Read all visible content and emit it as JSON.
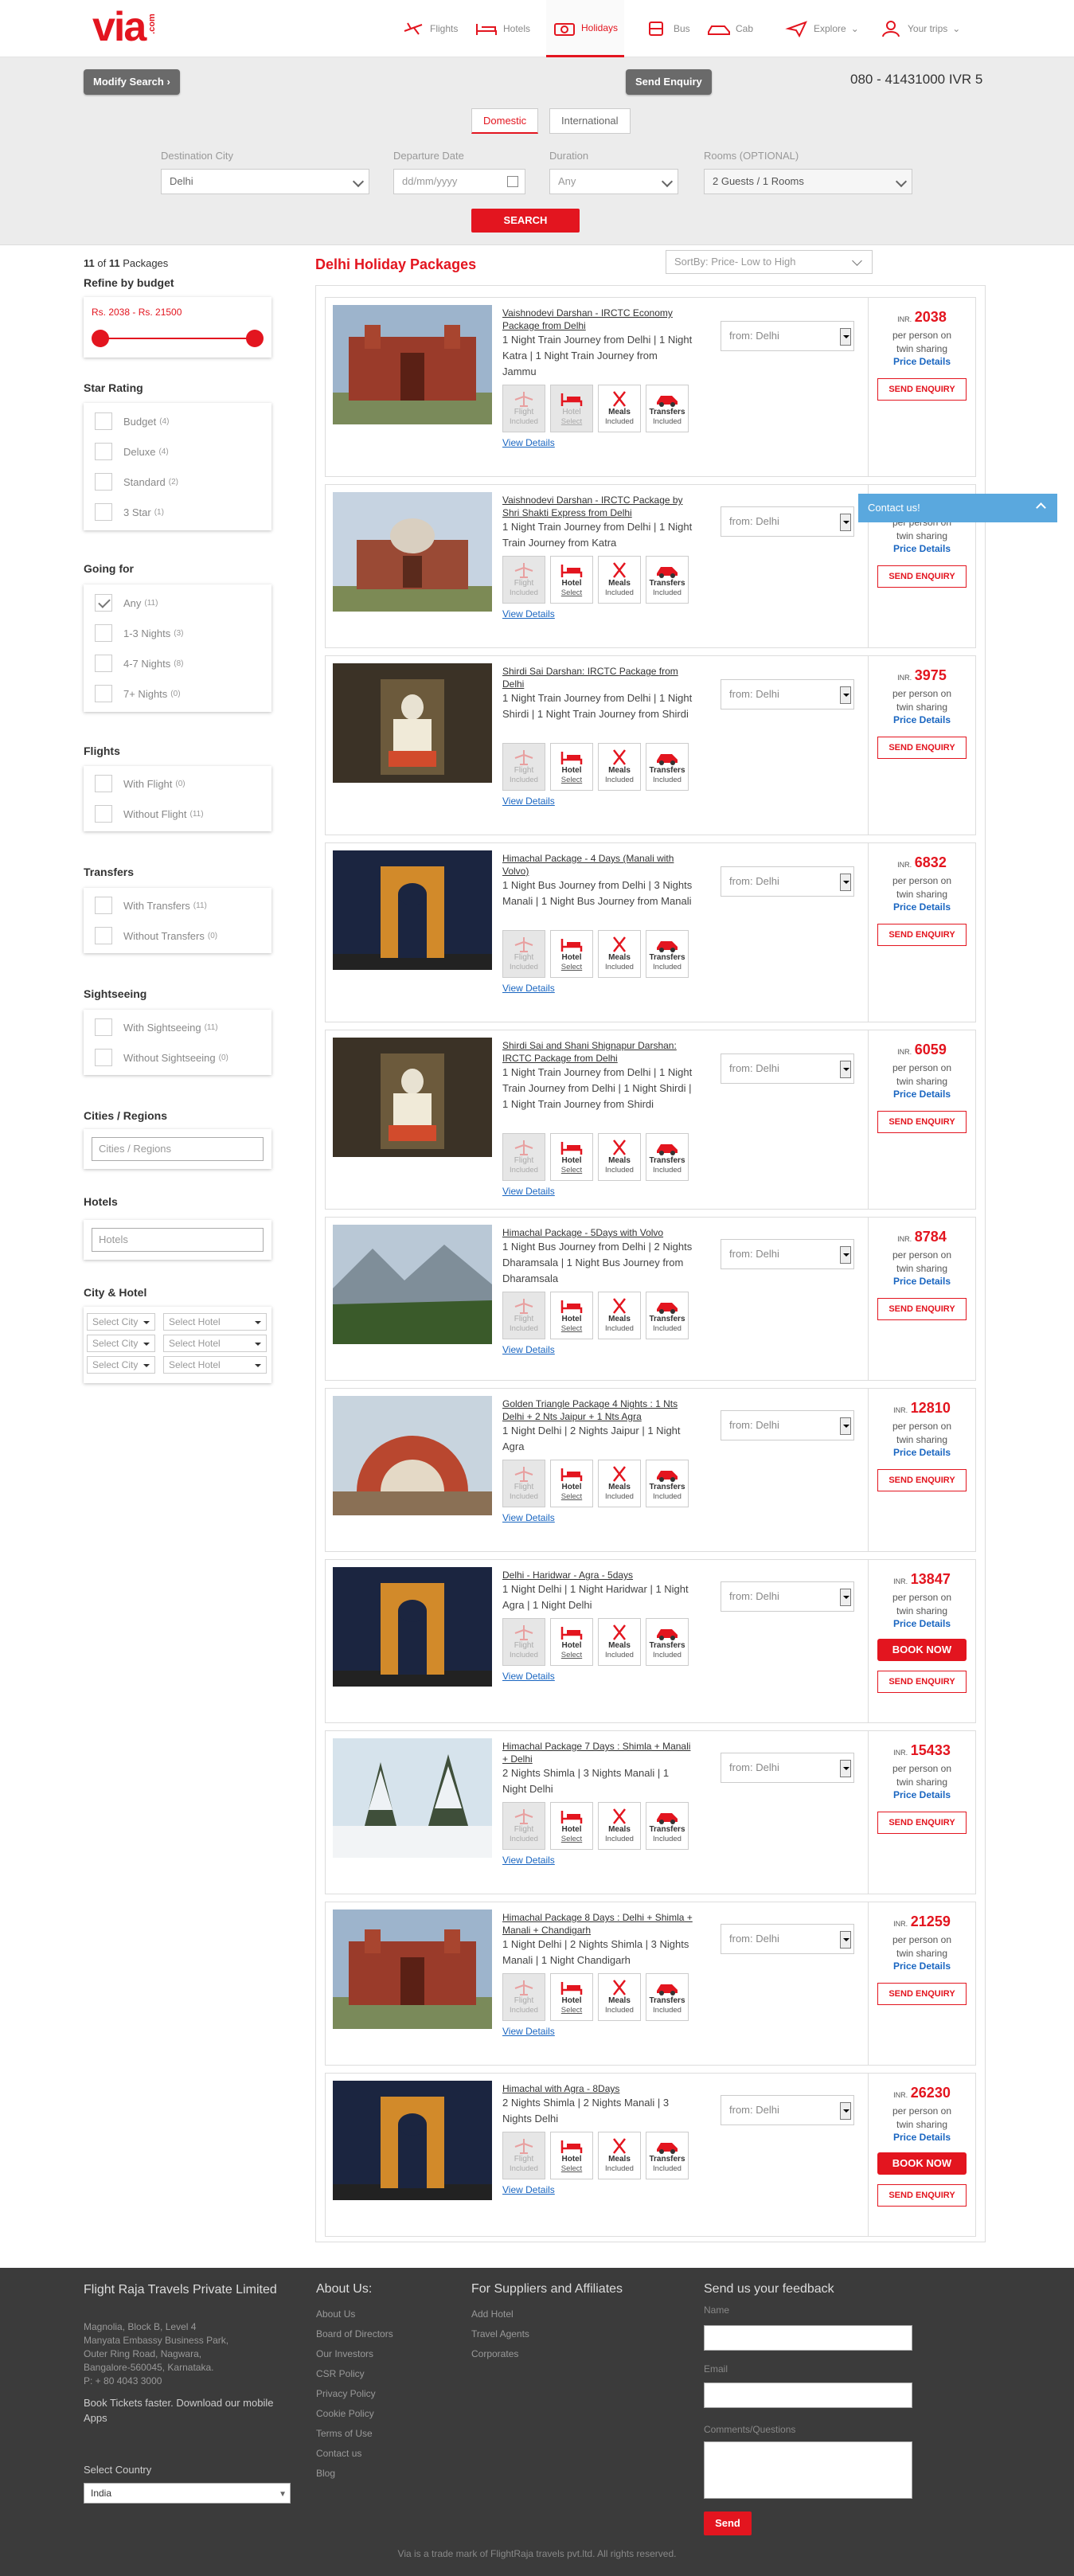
{
  "header": {
    "logo": "via",
    "logo_suffix": ".com",
    "nav": [
      {
        "label": "Flights",
        "icon": "plane-icon"
      },
      {
        "label": "Hotels",
        "icon": "bed-icon"
      },
      {
        "label": "Holidays",
        "icon": "camera-icon",
        "active": true
      },
      {
        "label": "Bus",
        "icon": "bus-icon"
      },
      {
        "label": "Cab",
        "icon": "car-icon"
      },
      {
        "label": "Explore",
        "icon": "paper-plane-icon"
      },
      {
        "label": "Your trips",
        "icon": "user-icon"
      }
    ]
  },
  "search": {
    "modify_label": "Modify Search",
    "send_enquiry_label": "Send Enquiry",
    "phone": "080 - 41431000 IVR 5",
    "tabs": [
      "Domestic",
      "International"
    ],
    "destination_label": "Destination City",
    "destination_value": "Delhi",
    "departure_label": "Departure Date",
    "departure_placeholder": "dd/mm/yyyy",
    "duration_label": "Duration",
    "duration_value": "Any",
    "rooms_label": "Rooms (OPTIONAL)",
    "rooms_value": "2 Guests / 1 Rooms",
    "search_label": "SEARCH"
  },
  "sidebar": {
    "count_shown": "11",
    "count_of": " of ",
    "count_total": "11",
    "count_suffix": " Packages",
    "budget_title": "Refine by budget",
    "budget_range": "Rs. 2038 - Rs. 21500",
    "budget_min": 2038,
    "budget_max": 21500,
    "star_title": "Star Rating",
    "star": [
      {
        "label": "Budget",
        "count": "(4)"
      },
      {
        "label": "Deluxe",
        "count": "(4)"
      },
      {
        "label": "Standard",
        "count": "(2)"
      },
      {
        "label": "3 Star",
        "count": "(1)"
      }
    ],
    "going_title": "Going for",
    "going": [
      {
        "label": "Any",
        "count": "(11)",
        "checked": true
      },
      {
        "label": "1-3 Nights",
        "count": "(3)"
      },
      {
        "label": "4-7 Nights",
        "count": "(8)"
      },
      {
        "label": "7+ Nights",
        "count": "(0)"
      }
    ],
    "flights_title": "Flights",
    "flights": [
      {
        "label": "With Flight",
        "count": "(0)"
      },
      {
        "label": "Without Flight",
        "count": "(11)"
      }
    ],
    "transfers_title": "Transfers",
    "transfers": [
      {
        "label": "With Transfers",
        "count": "(11)"
      },
      {
        "label": "Without Transfers",
        "count": "(0)"
      }
    ],
    "sightseeing_title": "Sightseeing",
    "sightseeing": [
      {
        "label": "With Sightseeing",
        "count": "(11)"
      },
      {
        "label": "Without Sightseeing",
        "count": "(0)"
      }
    ],
    "cities_title": "Cities / Regions",
    "cities_placeholder": "Cities / Regions",
    "hotels_title": "Hotels",
    "hotels_placeholder": "Hotels",
    "cityhotel_title": "City & Hotel",
    "select_city": "Select City",
    "select_hotel": "Select Hotel"
  },
  "listing": {
    "title": "Delhi Holiday Packages",
    "sort_label": "SortBy: Price- Low to High",
    "contact_label": "Contact us!",
    "view_details": "View Details",
    "from_label": "from: Delhi",
    "inr": "INR.",
    "per_person": "per person on twin sharing",
    "price_details": "Price Details",
    "send_enquiry": "SEND ENQUIRY",
    "book_now": "BOOK NOW",
    "features": {
      "flight": "Flight",
      "flight_sub": "Included",
      "hotel": "Hotel",
      "hotel_sub": "Select",
      "meals": "Meals",
      "meals_sub": "Included",
      "transfers": "Transfers",
      "transfers_sub": "Included"
    },
    "packages": [
      {
        "name": "Vaishnodevi Darshan - IRCTC Economy Package from Delhi",
        "desc": "1 Night Train Journey from  Delhi | 1 Night Katra | 1 Night Train Journey from  Jammu",
        "price": "2038",
        "image": "fort-icon",
        "hotel_dim": true,
        "book": false
      },
      {
        "name": "Vaishnodevi Darshan - IRCTC Package by Shri Shakti Express from Delhi",
        "desc": "1 Night Train Journey from  Delhi | 1 Night Train Journey from  Katra",
        "price": "",
        "image": "tomb-icon",
        "hotel_dim": false,
        "book": false
      },
      {
        "name": "Shirdi Sai Darshan: IRCTC Package from Delhi",
        "desc": "1 Night Train Journey from  Delhi | 1 Night Shirdi | 1 Night Train Journey from  Shirdi",
        "price": "3975",
        "image": "idol-icon",
        "hotel_dim": false,
        "book": false
      },
      {
        "name": "Himachal Package - 4 Days (Manali with Volvo)",
        "desc": "1 Night Bus Journey from  Delhi | 3 Nights Manali | 1 Night Bus Journey from  Manali",
        "price": "6832",
        "image": "gate-icon",
        "hotel_dim": false,
        "book": false
      },
      {
        "name": "Shirdi Sai and Shani Shignapur Darshan: IRCTC Package from Delhi",
        "desc": "1 Night Train Journey from  Delhi | 1 Night Train Journey from  Delhi | 1 Night Shirdi | 1 Night Train Journey from  Shirdi",
        "price": "6059",
        "image": "idol-icon",
        "hotel_dim": false,
        "book": false
      },
      {
        "name": "Himachal Package - 5Days with Volvo",
        "desc": "1 Night Bus Journey from  Delhi | 2 Nights Dharamsala | 1 Night Bus Journey from  Dharamsala",
        "price": "8784",
        "image": "mountain-icon",
        "hotel_dim": false,
        "book": false
      },
      {
        "name": "Golden Triangle Package 4 Nights : 1 Nts Delhi + 2 Nts Jaipur + 1 Nts Agra",
        "desc": "1 Night Delhi | 2 Nights Jaipur | 1 Night Agra",
        "price": "12810",
        "image": "jantar-icon",
        "hotel_dim": false,
        "book": false
      },
      {
        "name": "Delhi - Haridwar - Agra - 5days",
        "desc": "1 Night Delhi | 1 Night Haridwar | 1 Night Agra | 1 Night Delhi",
        "price": "13847",
        "image": "gate-icon",
        "hotel_dim": false,
        "book": true
      },
      {
        "name": "Himachal Package 7 Days : Shimla + Manali + Delhi",
        "desc": "2 Nights Shimla | 3 Nights Manali | 1 Night Delhi",
        "price": "15433",
        "image": "snow-icon",
        "hotel_dim": false,
        "book": false
      },
      {
        "name": "Himachal Package 8 Days : Delhi + Shimla + Manali + Chandigarh",
        "desc": "1 Night Delhi | 2 Nights Shimla | 3 Nights Manali | 1 Night Chandigarh",
        "price": "21259",
        "image": "fort-icon",
        "hotel_dim": false,
        "book": false
      },
      {
        "name": "Himachal with Agra - 8Days",
        "desc": "2 Nights Shimla | 2 Nights Manali | 3 Nights Delhi",
        "price": "26230",
        "image": "gate-icon",
        "hotel_dim": false,
        "book": true
      }
    ]
  },
  "footer": {
    "company": "Flight Raja Travels Private Limited",
    "address": [
      "Magnolia, Block B, Level 4",
      "Manyata Embassy Business Park,",
      "Outer Ring Road, Nagwara,",
      "Bangalore-560045, Karnataka.",
      "P: + 80 4043 3000"
    ],
    "apps_text": "Book Tickets faster. Download our mobile Apps",
    "country_label": "Select Country",
    "country_value": "India",
    "about_title": "About Us:",
    "about_links": [
      "About Us",
      "Board of Directors",
      "Our Investors",
      "CSR Policy",
      "Privacy Policy",
      "Cookie Policy",
      "Terms of Use",
      "Contact us",
      "Blog"
    ],
    "suppliers_title": "For Suppliers and Affiliates",
    "suppliers_links": [
      "Add Hotel",
      "Travel Agents",
      "Corporates"
    ],
    "feedback_title": "Send us your feedback",
    "name_label": "Name",
    "email_label": "Email",
    "comments_label": "Comments/Questions",
    "send_label": "Send",
    "trademark": "Via is a trade mark of FlightRaja travels pvt.ltd. All rights reserved."
  },
  "colors": {
    "brand": "#e3151f",
    "link": "#1a66c1",
    "footer": "#3b3b3b",
    "panel": "#ececec"
  }
}
